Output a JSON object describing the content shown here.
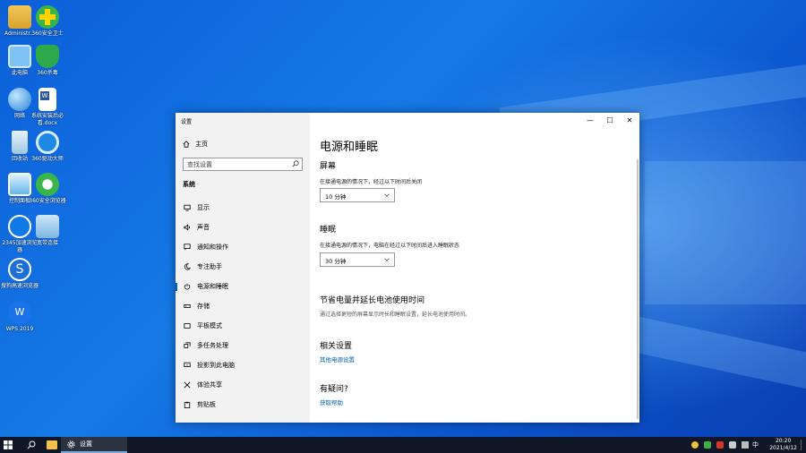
{
  "desktop": {
    "icons": [
      {
        "label": "Administr..."
      },
      {
        "label": "360安全卫士"
      },
      {
        "label": "此电脑"
      },
      {
        "label": "360杀毒"
      },
      {
        "label": "网络"
      },
      {
        "label": "系统安装后必看.docx"
      },
      {
        "label": "回收站"
      },
      {
        "label": "360驱动大师"
      },
      {
        "label": "控制面板"
      },
      {
        "label": "360安全浏览器"
      },
      {
        "label": "2345加速浏览器"
      },
      {
        "label": "宽带连接"
      },
      {
        "label": "搜狗高速浏览器"
      },
      {
        "label": "WPS 2019"
      }
    ]
  },
  "window": {
    "title": "设置",
    "minimize": "—",
    "maximize": "☐",
    "close": "✕"
  },
  "sidebar": {
    "home_label": "主页",
    "search_placeholder": "查找设置",
    "group_label": "系统",
    "items": [
      {
        "label": "显示",
        "icon": "monitor-icon"
      },
      {
        "label": "声音",
        "icon": "speaker-icon"
      },
      {
        "label": "通知和操作",
        "icon": "notification-icon"
      },
      {
        "label": "专注助手",
        "icon": "moon-icon"
      },
      {
        "label": "电源和睡眠",
        "icon": "power-icon",
        "selected": true
      },
      {
        "label": "存储",
        "icon": "storage-icon"
      },
      {
        "label": "平板模式",
        "icon": "tablet-icon"
      },
      {
        "label": "多任务处理",
        "icon": "multitask-icon"
      },
      {
        "label": "投影到此电脑",
        "icon": "project-icon"
      },
      {
        "label": "体验共享",
        "icon": "share-icon"
      },
      {
        "label": "剪贴板",
        "icon": "clipboard-icon"
      }
    ]
  },
  "main": {
    "page_title": "电源和睡眠",
    "screen": {
      "heading": "屏幕",
      "description": "在接通电源的情况下，经过以下时间后关闭",
      "value": "10 分钟"
    },
    "sleep": {
      "heading": "睡眠",
      "description": "在接通电源的情况下，电脑在经过以下时间后进入睡眠状态",
      "value": "30 分钟"
    },
    "battery": {
      "heading": "节省电量并延长电池使用时间",
      "description": "通过选择更短的屏幕显示时长和睡眠设置，延长电池使用时间。"
    },
    "related": {
      "heading": "相关设置",
      "link": "其他电源设置"
    },
    "help": {
      "heading": "有疑问?",
      "link": "获取帮助"
    }
  },
  "taskbar": {
    "active_app": "设置",
    "time": "20:20",
    "date": "2021/4/12",
    "ime": "中"
  },
  "colors": {
    "accent": "#0063b1",
    "taskbar": "#101726"
  }
}
